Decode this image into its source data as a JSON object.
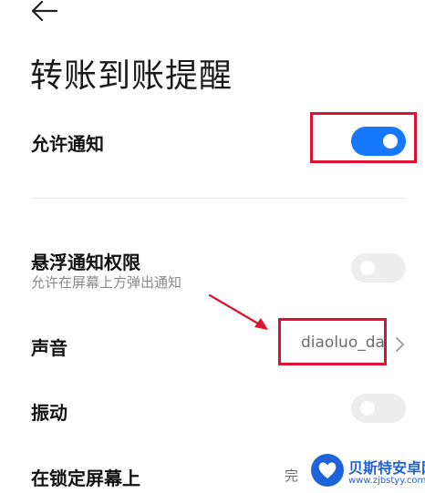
{
  "header": {
    "back_icon": "arrow-left-icon",
    "title": "转账到账提醒"
  },
  "settings": {
    "allow_notifications": {
      "label": "允许通知",
      "enabled": true
    },
    "floating_notifications": {
      "label": "悬浮通知权限",
      "subtitle": "允许在屏幕上方弹出通知",
      "enabled": false
    },
    "sound": {
      "label": "声音",
      "value": "diaoluo_da",
      "chevron_icon": "chevron-right-icon"
    },
    "vibration": {
      "label": "振动",
      "enabled": false
    },
    "lock_screen": {
      "label": "在锁定屏幕上",
      "value": "完"
    }
  },
  "watermark": {
    "name": "贝斯特安卓网",
    "url": "www.zjbstyy.com",
    "logo_icon": "heart-logo-icon"
  },
  "colors": {
    "toggle_on": "#1677ff",
    "toggle_off": "#ededed",
    "highlight": "#e0102f",
    "watermark_blue": "#1f63d8"
  }
}
